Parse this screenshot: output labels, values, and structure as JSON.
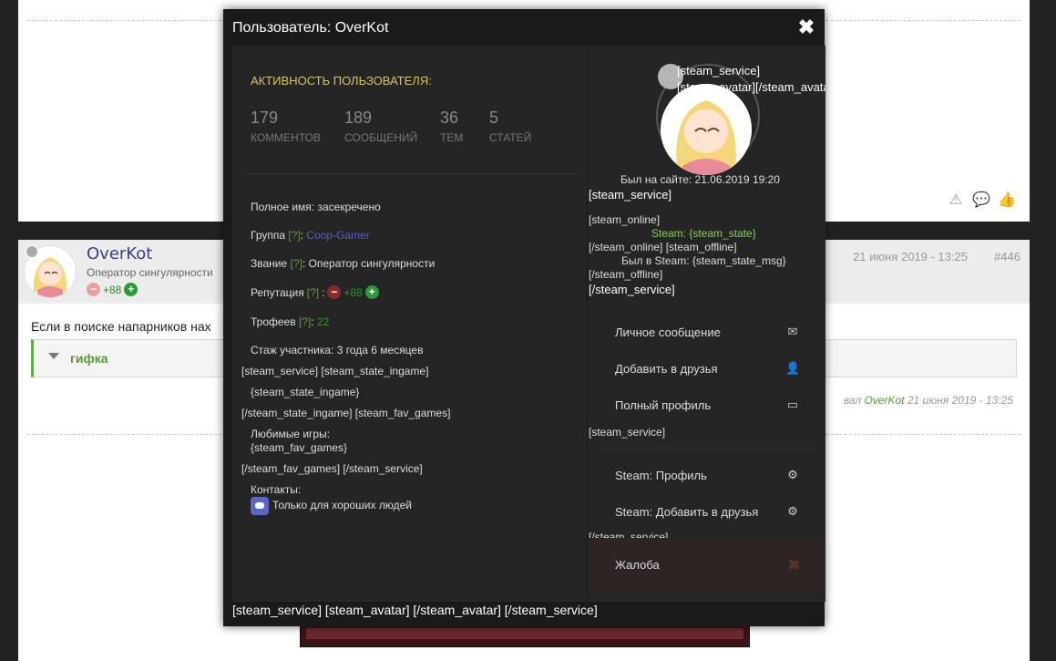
{
  "post": {
    "author": "OverKot",
    "rank": "Оператор сингулярности",
    "reputation": "+88",
    "date": "21 июня 2019 - 13:25",
    "number": "#446",
    "text": "Если в поиске напарников нах",
    "spoiler_title": "гифка",
    "edited_by_prefix": "вал",
    "edited_by_user": "OverKot",
    "edited_by_date": "21 июня 2019 - 13:25"
  },
  "modal": {
    "title": "Пользователь: OverKot",
    "close_icon": "close-icon",
    "activity": {
      "title": "АКТИВНОСТЬ ПОЛЬЗОВАТЕЛЯ:",
      "stats": [
        {
          "value": "179",
          "label": "КОММЕНТОВ"
        },
        {
          "value": "189",
          "label": "СООБЩЕНИЙ"
        },
        {
          "value": "36",
          "label": "ТЕМ"
        },
        {
          "value": "5",
          "label": "СТАТЕЙ"
        }
      ]
    },
    "info": {
      "full_name_label": "Полное имя:",
      "full_name_value": "засекречено",
      "group_label": "Группа",
      "group_value": "Coop-Gamer",
      "rank_label": "Звание",
      "rank_value": "Оператор сингулярности",
      "rep_label": "Репутация",
      "rep_value": "+88",
      "trophies_label": "Трофеев",
      "trophies_value": "22",
      "tenure_label": "Стаж участника:",
      "tenure_value": "3 года 6 месяцев",
      "q": "[?]",
      "raw1": "[steam_service] [steam_state_ingame]",
      "raw2": "{steam_state_ingame}",
      "raw3": "[/steam_state_ingame] [steam_fav_games]",
      "fav_label": "Любимые игры:",
      "fav_value": "{steam_fav_games}",
      "raw4": "[/steam_fav_games] [/steam_service]",
      "contacts_label": "Контакты:",
      "contact_discord": "Только для хороших людей"
    },
    "profile": {
      "overlay_1": "[steam_service]",
      "overlay_2": "[steam_avatar][/steam_avatar]",
      "last_seen": "Был на сайте: 21.06.2019 19:20",
      "steam_service_open": "[steam_service]",
      "steam_online": "[steam_online]",
      "steam_state": "Steam: {steam_state}",
      "steam_online_close": "[/steam_online] [steam_offline]",
      "steam_state_msg": "Был в Steam: {steam_state_msg}",
      "steam_offline_close": "[/steam_offline]",
      "steam_service_close": "[/steam_service]",
      "steam_service_2": "[steam_service]",
      "steam_service_close_2": "[/steam_service]"
    },
    "menu": [
      {
        "label": "Личное сообщение",
        "icon": "envelope-icon"
      },
      {
        "label": "Добавить в друзья",
        "icon": "user-icon"
      },
      {
        "label": "Полный профиль",
        "icon": "id-card-icon"
      }
    ],
    "steam_menu": [
      {
        "label": "Steam: Профиль",
        "icon": "steam-icon"
      },
      {
        "label": "Steam: Добавить в друзья",
        "icon": "steam-icon"
      }
    ],
    "report": {
      "label": "Жалоба",
      "icon": "close-icon"
    },
    "footer": "[steam_service] [steam_avatar] [/steam_avatar] [/steam_service]"
  }
}
